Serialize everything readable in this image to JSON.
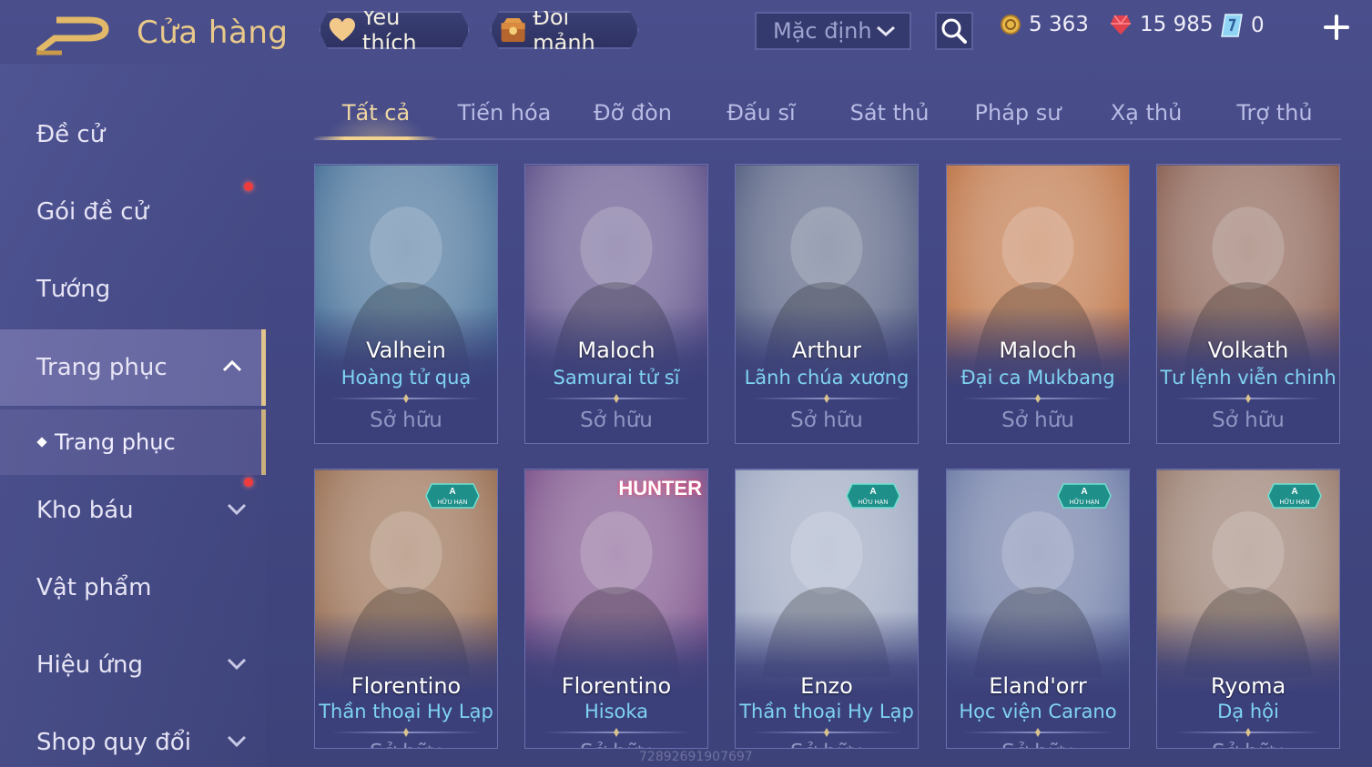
{
  "header": {
    "title": "Cửa hàng",
    "favorites_label": "Yêu thích",
    "exchange_label": "Đổi mảnh",
    "sort_value": "Mặc định",
    "gold": "5 363",
    "ruby": "15 985",
    "voucher": "0"
  },
  "sidebar": {
    "items": [
      {
        "label": "Đề cử"
      },
      {
        "label": "Gói đề cử"
      },
      {
        "label": "Tướng"
      },
      {
        "label": "Trang phục"
      },
      {
        "label": "Kho báu"
      },
      {
        "label": "Vật phẩm"
      },
      {
        "label": "Hiệu ứng"
      },
      {
        "label": "Shop quy đổi"
      }
    ],
    "sub_item": "Trang phục"
  },
  "tabs": [
    {
      "label": "Tất cả"
    },
    {
      "label": "Tiến hóa"
    },
    {
      "label": "Đỡ đòn"
    },
    {
      "label": "Đấu sĩ"
    },
    {
      "label": "Sát thủ"
    },
    {
      "label": "Pháp sư"
    },
    {
      "label": "Xạ thủ"
    },
    {
      "label": "Trợ thủ"
    }
  ],
  "cards": [
    {
      "hero": "Valhein",
      "skin": "Hoàng tử quạ",
      "status": "Sở hữu",
      "color": "#2d5d8a"
    },
    {
      "hero": "Maloch",
      "skin": "Samurai tử sĩ",
      "status": "Sở hữu",
      "color": "#4a3a7a"
    },
    {
      "hero": "Arthur",
      "skin": "Lãnh chúa xương",
      "status": "Sở hữu",
      "color": "#3e4a70"
    },
    {
      "hero": "Maloch",
      "skin": "Đại ca Mukbang",
      "status": "Sở hữu",
      "color": "#b5622e"
    },
    {
      "hero": "Volkath",
      "skin": "Tư lệnh viễn chinh",
      "status": "Sở hữu",
      "color": "#7a4a3a"
    },
    {
      "hero": "Florentino",
      "skin": "Thần thoại Hy Lạp",
      "status": "Sở hữu",
      "color": "#8a5a3a",
      "badge": true
    },
    {
      "hero": "Florentino",
      "skin": "Hisoka",
      "status": "Sở hữu",
      "color": "#6a3a7a"
    },
    {
      "hero": "Enzo",
      "skin": "Thần thoại Hy Lạp",
      "status": "Sở hữu",
      "color": "#8f9bb8",
      "badge": true
    },
    {
      "hero": "Eland'orr",
      "skin": "Học viện Carano",
      "status": "Sở hữu",
      "color": "#5a6a9a",
      "badge": true
    },
    {
      "hero": "Ryoma",
      "skin": "Dạ hội",
      "status": "Sở hữu",
      "color": "#8a6a5a",
      "badge": true
    }
  ],
  "badge_text": {
    "grade": "A",
    "label": "HỮU HẠN"
  },
  "hunter_logo": "HUNTER",
  "watermark": "72892691907697"
}
